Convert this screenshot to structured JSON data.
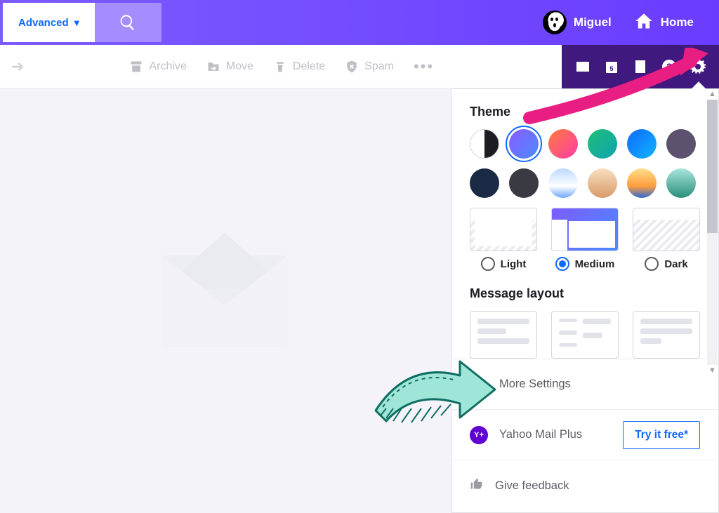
{
  "header": {
    "advanced_label": "Advanced",
    "user_name": "Miguel",
    "home_label": "Home"
  },
  "toolbar": {
    "archive": "Archive",
    "move": "Move",
    "delete": "Delete",
    "spam": "Spam"
  },
  "settings": {
    "theme_heading": "Theme",
    "density": {
      "light": "Light",
      "medium": "Medium",
      "dark": "Dark"
    },
    "message_layout_heading": "Message layout",
    "more_settings": "More Settings",
    "mail_plus_label": "Yahoo Mail Plus",
    "mail_plus_cta": "Try it free*",
    "feedback": "Give feedback",
    "yplus_badge": "Y+"
  }
}
